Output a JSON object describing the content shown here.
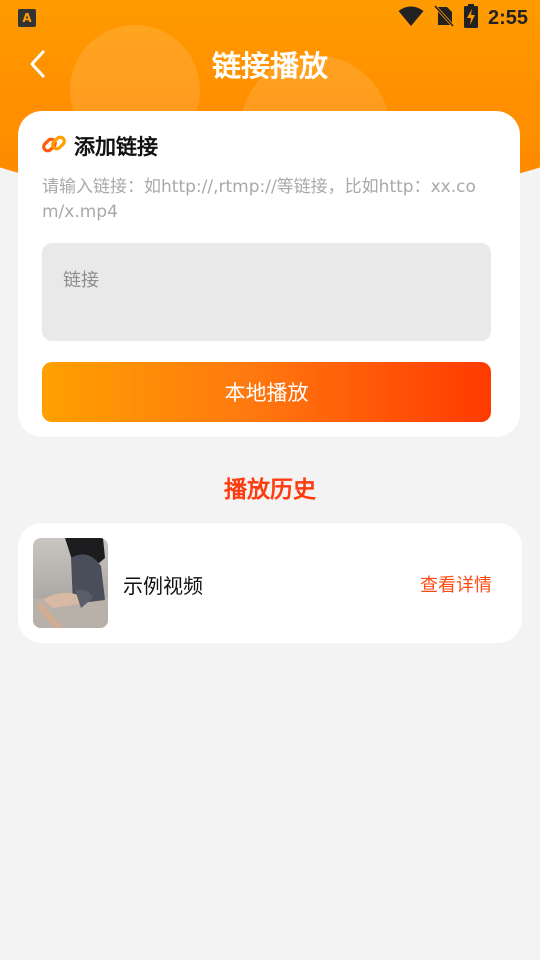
{
  "status_bar": {
    "app_icon_letter": "A",
    "time": "2:55",
    "icons": [
      "wifi-icon",
      "no-sim-icon",
      "battery-charging-icon"
    ]
  },
  "nav": {
    "back_icon": "chevron-left-icon",
    "title": "链接播放"
  },
  "add_link": {
    "icon": "link-icon",
    "title": "添加链接",
    "hint": "请输入链接：如http://,rtmp://等链接，比如http：xx.com/x.mp4",
    "input_placeholder": "链接",
    "input_value": "",
    "button_label": "本地播放"
  },
  "history": {
    "title": "播放历史",
    "items": [
      {
        "name": "示例视频",
        "action_label": "查看详情"
      }
    ]
  },
  "colors": {
    "header_orange": "#ffa000",
    "accent_red": "#ff3b0f",
    "button_gradient_start": "#ffa000",
    "button_gradient_end": "#ff3a00",
    "background": "#f3f3f3"
  }
}
